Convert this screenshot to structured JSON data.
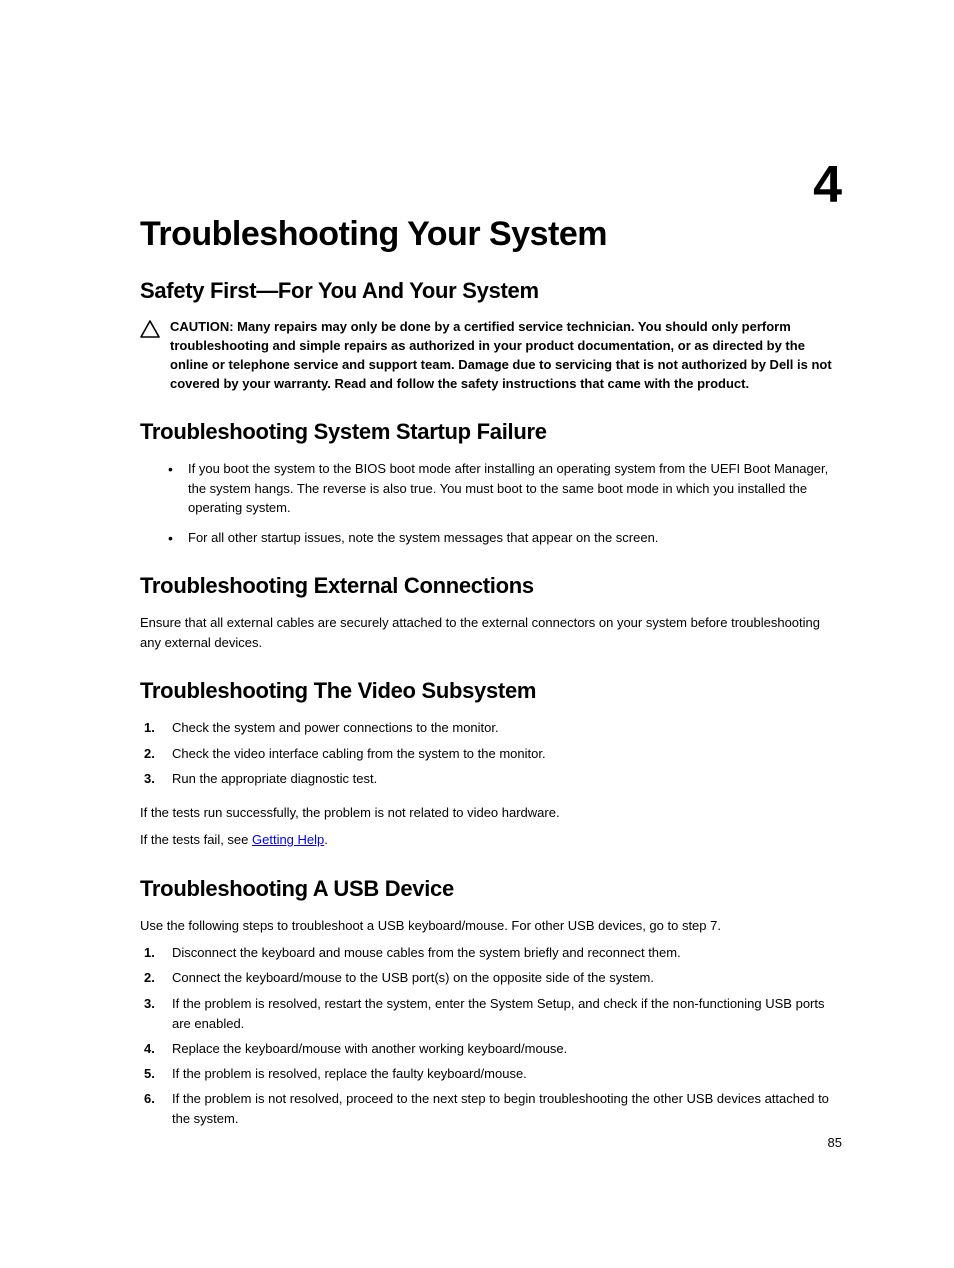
{
  "chapterNumber": "4",
  "title": "Troubleshooting Your System",
  "pageNumber": "85",
  "sections": {
    "safety": {
      "heading": "Safety First—For You And Your System",
      "cautionLabel": "CAUTION: ",
      "cautionText": "Many repairs may only be done by a certified service technician. You should only perform troubleshooting and simple repairs as authorized in your product documentation, or as directed by the online or telephone service and support team. Damage due to servicing that is not authorized by Dell is not covered by your warranty. Read and follow the safety instructions that came with the product."
    },
    "startup": {
      "heading": "Troubleshooting System Startup Failure",
      "bullets": [
        "If you boot the system to the BIOS boot mode after installing an operating system from the UEFI Boot Manager, the system hangs. The reverse is also true. You must boot to the same boot mode in which you installed the operating system.",
        "For all other startup issues, note the system messages that appear on the screen."
      ]
    },
    "external": {
      "heading": "Troubleshooting External Connections",
      "body": "Ensure that all external cables are securely attached to the external connectors on your system before troubleshooting any external devices."
    },
    "video": {
      "heading": "Troubleshooting The Video Subsystem",
      "steps": [
        "Check the system and power connections to the monitor.",
        "Check the video interface cabling from the system to the monitor.",
        "Run the appropriate diagnostic test."
      ],
      "after1": "If the tests run successfully, the problem is not related to video hardware.",
      "after2a": "If the tests fail, see ",
      "after2link": "Getting Help",
      "after2b": "."
    },
    "usb": {
      "heading": "Troubleshooting A USB Device",
      "intro": "Use the following steps to troubleshoot a USB keyboard/mouse. For other USB devices, go to step 7.",
      "steps": [
        "Disconnect the keyboard and mouse cables from the system briefly and reconnect them.",
        "Connect the keyboard/mouse to the USB port(s) on the opposite side of the system.",
        "If the problem is resolved, restart the system, enter the System Setup, and check if the non-functioning USB ports are enabled.",
        "Replace the keyboard/mouse with another working keyboard/mouse.",
        "If the problem is resolved, replace the faulty keyboard/mouse.",
        "If the problem is not resolved, proceed to the next step to begin troubleshooting the other USB devices attached to the system."
      ]
    }
  }
}
